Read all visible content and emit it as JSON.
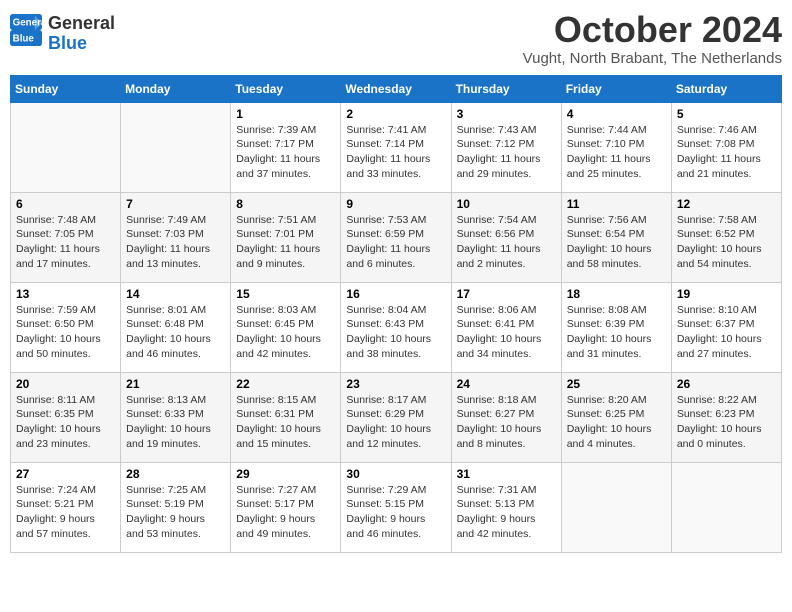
{
  "header": {
    "logo_line1": "General",
    "logo_line2": "Blue",
    "month": "October 2024",
    "location": "Vught, North Brabant, The Netherlands"
  },
  "weekdays": [
    "Sunday",
    "Monday",
    "Tuesday",
    "Wednesday",
    "Thursday",
    "Friday",
    "Saturday"
  ],
  "weeks": [
    [
      {
        "day": "",
        "sunrise": "",
        "sunset": "",
        "daylight": ""
      },
      {
        "day": "",
        "sunrise": "",
        "sunset": "",
        "daylight": ""
      },
      {
        "day": "1",
        "sunrise": "Sunrise: 7:39 AM",
        "sunset": "Sunset: 7:17 PM",
        "daylight": "Daylight: 11 hours and 37 minutes."
      },
      {
        "day": "2",
        "sunrise": "Sunrise: 7:41 AM",
        "sunset": "Sunset: 7:14 PM",
        "daylight": "Daylight: 11 hours and 33 minutes."
      },
      {
        "day": "3",
        "sunrise": "Sunrise: 7:43 AM",
        "sunset": "Sunset: 7:12 PM",
        "daylight": "Daylight: 11 hours and 29 minutes."
      },
      {
        "day": "4",
        "sunrise": "Sunrise: 7:44 AM",
        "sunset": "Sunset: 7:10 PM",
        "daylight": "Daylight: 11 hours and 25 minutes."
      },
      {
        "day": "5",
        "sunrise": "Sunrise: 7:46 AM",
        "sunset": "Sunset: 7:08 PM",
        "daylight": "Daylight: 11 hours and 21 minutes."
      }
    ],
    [
      {
        "day": "6",
        "sunrise": "Sunrise: 7:48 AM",
        "sunset": "Sunset: 7:05 PM",
        "daylight": "Daylight: 11 hours and 17 minutes."
      },
      {
        "day": "7",
        "sunrise": "Sunrise: 7:49 AM",
        "sunset": "Sunset: 7:03 PM",
        "daylight": "Daylight: 11 hours and 13 minutes."
      },
      {
        "day": "8",
        "sunrise": "Sunrise: 7:51 AM",
        "sunset": "Sunset: 7:01 PM",
        "daylight": "Daylight: 11 hours and 9 minutes."
      },
      {
        "day": "9",
        "sunrise": "Sunrise: 7:53 AM",
        "sunset": "Sunset: 6:59 PM",
        "daylight": "Daylight: 11 hours and 6 minutes."
      },
      {
        "day": "10",
        "sunrise": "Sunrise: 7:54 AM",
        "sunset": "Sunset: 6:56 PM",
        "daylight": "Daylight: 11 hours and 2 minutes."
      },
      {
        "day": "11",
        "sunrise": "Sunrise: 7:56 AM",
        "sunset": "Sunset: 6:54 PM",
        "daylight": "Daylight: 10 hours and 58 minutes."
      },
      {
        "day": "12",
        "sunrise": "Sunrise: 7:58 AM",
        "sunset": "Sunset: 6:52 PM",
        "daylight": "Daylight: 10 hours and 54 minutes."
      }
    ],
    [
      {
        "day": "13",
        "sunrise": "Sunrise: 7:59 AM",
        "sunset": "Sunset: 6:50 PM",
        "daylight": "Daylight: 10 hours and 50 minutes."
      },
      {
        "day": "14",
        "sunrise": "Sunrise: 8:01 AM",
        "sunset": "Sunset: 6:48 PM",
        "daylight": "Daylight: 10 hours and 46 minutes."
      },
      {
        "day": "15",
        "sunrise": "Sunrise: 8:03 AM",
        "sunset": "Sunset: 6:45 PM",
        "daylight": "Daylight: 10 hours and 42 minutes."
      },
      {
        "day": "16",
        "sunrise": "Sunrise: 8:04 AM",
        "sunset": "Sunset: 6:43 PM",
        "daylight": "Daylight: 10 hours and 38 minutes."
      },
      {
        "day": "17",
        "sunrise": "Sunrise: 8:06 AM",
        "sunset": "Sunset: 6:41 PM",
        "daylight": "Daylight: 10 hours and 34 minutes."
      },
      {
        "day": "18",
        "sunrise": "Sunrise: 8:08 AM",
        "sunset": "Sunset: 6:39 PM",
        "daylight": "Daylight: 10 hours and 31 minutes."
      },
      {
        "day": "19",
        "sunrise": "Sunrise: 8:10 AM",
        "sunset": "Sunset: 6:37 PM",
        "daylight": "Daylight: 10 hours and 27 minutes."
      }
    ],
    [
      {
        "day": "20",
        "sunrise": "Sunrise: 8:11 AM",
        "sunset": "Sunset: 6:35 PM",
        "daylight": "Daylight: 10 hours and 23 minutes."
      },
      {
        "day": "21",
        "sunrise": "Sunrise: 8:13 AM",
        "sunset": "Sunset: 6:33 PM",
        "daylight": "Daylight: 10 hours and 19 minutes."
      },
      {
        "day": "22",
        "sunrise": "Sunrise: 8:15 AM",
        "sunset": "Sunset: 6:31 PM",
        "daylight": "Daylight: 10 hours and 15 minutes."
      },
      {
        "day": "23",
        "sunrise": "Sunrise: 8:17 AM",
        "sunset": "Sunset: 6:29 PM",
        "daylight": "Daylight: 10 hours and 12 minutes."
      },
      {
        "day": "24",
        "sunrise": "Sunrise: 8:18 AM",
        "sunset": "Sunset: 6:27 PM",
        "daylight": "Daylight: 10 hours and 8 minutes."
      },
      {
        "day": "25",
        "sunrise": "Sunrise: 8:20 AM",
        "sunset": "Sunset: 6:25 PM",
        "daylight": "Daylight: 10 hours and 4 minutes."
      },
      {
        "day": "26",
        "sunrise": "Sunrise: 8:22 AM",
        "sunset": "Sunset: 6:23 PM",
        "daylight": "Daylight: 10 hours and 0 minutes."
      }
    ],
    [
      {
        "day": "27",
        "sunrise": "Sunrise: 7:24 AM",
        "sunset": "Sunset: 5:21 PM",
        "daylight": "Daylight: 9 hours and 57 minutes."
      },
      {
        "day": "28",
        "sunrise": "Sunrise: 7:25 AM",
        "sunset": "Sunset: 5:19 PM",
        "daylight": "Daylight: 9 hours and 53 minutes."
      },
      {
        "day": "29",
        "sunrise": "Sunrise: 7:27 AM",
        "sunset": "Sunset: 5:17 PM",
        "daylight": "Daylight: 9 hours and 49 minutes."
      },
      {
        "day": "30",
        "sunrise": "Sunrise: 7:29 AM",
        "sunset": "Sunset: 5:15 PM",
        "daylight": "Daylight: 9 hours and 46 minutes."
      },
      {
        "day": "31",
        "sunrise": "Sunrise: 7:31 AM",
        "sunset": "Sunset: 5:13 PM",
        "daylight": "Daylight: 9 hours and 42 minutes."
      },
      {
        "day": "",
        "sunrise": "",
        "sunset": "",
        "daylight": ""
      },
      {
        "day": "",
        "sunrise": "",
        "sunset": "",
        "daylight": ""
      }
    ]
  ]
}
